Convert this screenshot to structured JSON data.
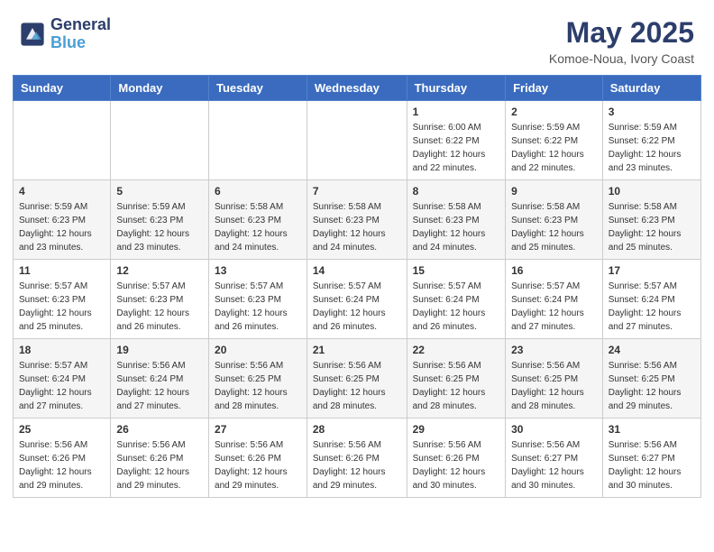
{
  "header": {
    "logo_line1": "General",
    "logo_line2": "Blue",
    "month_year": "May 2025",
    "location": "Komoe-Noua, Ivory Coast"
  },
  "days_of_week": [
    "Sunday",
    "Monday",
    "Tuesday",
    "Wednesday",
    "Thursday",
    "Friday",
    "Saturday"
  ],
  "weeks": [
    [
      {
        "day": "",
        "info": ""
      },
      {
        "day": "",
        "info": ""
      },
      {
        "day": "",
        "info": ""
      },
      {
        "day": "",
        "info": ""
      },
      {
        "day": "1",
        "info": "Sunrise: 6:00 AM\nSunset: 6:22 PM\nDaylight: 12 hours\nand 22 minutes."
      },
      {
        "day": "2",
        "info": "Sunrise: 5:59 AM\nSunset: 6:22 PM\nDaylight: 12 hours\nand 22 minutes."
      },
      {
        "day": "3",
        "info": "Sunrise: 5:59 AM\nSunset: 6:22 PM\nDaylight: 12 hours\nand 23 minutes."
      }
    ],
    [
      {
        "day": "4",
        "info": "Sunrise: 5:59 AM\nSunset: 6:23 PM\nDaylight: 12 hours\nand 23 minutes."
      },
      {
        "day": "5",
        "info": "Sunrise: 5:59 AM\nSunset: 6:23 PM\nDaylight: 12 hours\nand 23 minutes."
      },
      {
        "day": "6",
        "info": "Sunrise: 5:58 AM\nSunset: 6:23 PM\nDaylight: 12 hours\nand 24 minutes."
      },
      {
        "day": "7",
        "info": "Sunrise: 5:58 AM\nSunset: 6:23 PM\nDaylight: 12 hours\nand 24 minutes."
      },
      {
        "day": "8",
        "info": "Sunrise: 5:58 AM\nSunset: 6:23 PM\nDaylight: 12 hours\nand 24 minutes."
      },
      {
        "day": "9",
        "info": "Sunrise: 5:58 AM\nSunset: 6:23 PM\nDaylight: 12 hours\nand 25 minutes."
      },
      {
        "day": "10",
        "info": "Sunrise: 5:58 AM\nSunset: 6:23 PM\nDaylight: 12 hours\nand 25 minutes."
      }
    ],
    [
      {
        "day": "11",
        "info": "Sunrise: 5:57 AM\nSunset: 6:23 PM\nDaylight: 12 hours\nand 25 minutes."
      },
      {
        "day": "12",
        "info": "Sunrise: 5:57 AM\nSunset: 6:23 PM\nDaylight: 12 hours\nand 26 minutes."
      },
      {
        "day": "13",
        "info": "Sunrise: 5:57 AM\nSunset: 6:23 PM\nDaylight: 12 hours\nand 26 minutes."
      },
      {
        "day": "14",
        "info": "Sunrise: 5:57 AM\nSunset: 6:24 PM\nDaylight: 12 hours\nand 26 minutes."
      },
      {
        "day": "15",
        "info": "Sunrise: 5:57 AM\nSunset: 6:24 PM\nDaylight: 12 hours\nand 26 minutes."
      },
      {
        "day": "16",
        "info": "Sunrise: 5:57 AM\nSunset: 6:24 PM\nDaylight: 12 hours\nand 27 minutes."
      },
      {
        "day": "17",
        "info": "Sunrise: 5:57 AM\nSunset: 6:24 PM\nDaylight: 12 hours\nand 27 minutes."
      }
    ],
    [
      {
        "day": "18",
        "info": "Sunrise: 5:57 AM\nSunset: 6:24 PM\nDaylight: 12 hours\nand 27 minutes."
      },
      {
        "day": "19",
        "info": "Sunrise: 5:56 AM\nSunset: 6:24 PM\nDaylight: 12 hours\nand 27 minutes."
      },
      {
        "day": "20",
        "info": "Sunrise: 5:56 AM\nSunset: 6:25 PM\nDaylight: 12 hours\nand 28 minutes."
      },
      {
        "day": "21",
        "info": "Sunrise: 5:56 AM\nSunset: 6:25 PM\nDaylight: 12 hours\nand 28 minutes."
      },
      {
        "day": "22",
        "info": "Sunrise: 5:56 AM\nSunset: 6:25 PM\nDaylight: 12 hours\nand 28 minutes."
      },
      {
        "day": "23",
        "info": "Sunrise: 5:56 AM\nSunset: 6:25 PM\nDaylight: 12 hours\nand 28 minutes."
      },
      {
        "day": "24",
        "info": "Sunrise: 5:56 AM\nSunset: 6:25 PM\nDaylight: 12 hours\nand 29 minutes."
      }
    ],
    [
      {
        "day": "25",
        "info": "Sunrise: 5:56 AM\nSunset: 6:26 PM\nDaylight: 12 hours\nand 29 minutes."
      },
      {
        "day": "26",
        "info": "Sunrise: 5:56 AM\nSunset: 6:26 PM\nDaylight: 12 hours\nand 29 minutes."
      },
      {
        "day": "27",
        "info": "Sunrise: 5:56 AM\nSunset: 6:26 PM\nDaylight: 12 hours\nand 29 minutes."
      },
      {
        "day": "28",
        "info": "Sunrise: 5:56 AM\nSunset: 6:26 PM\nDaylight: 12 hours\nand 29 minutes."
      },
      {
        "day": "29",
        "info": "Sunrise: 5:56 AM\nSunset: 6:26 PM\nDaylight: 12 hours\nand 30 minutes."
      },
      {
        "day": "30",
        "info": "Sunrise: 5:56 AM\nSunset: 6:27 PM\nDaylight: 12 hours\nand 30 minutes."
      },
      {
        "day": "31",
        "info": "Sunrise: 5:56 AM\nSunset: 6:27 PM\nDaylight: 12 hours\nand 30 minutes."
      }
    ]
  ]
}
